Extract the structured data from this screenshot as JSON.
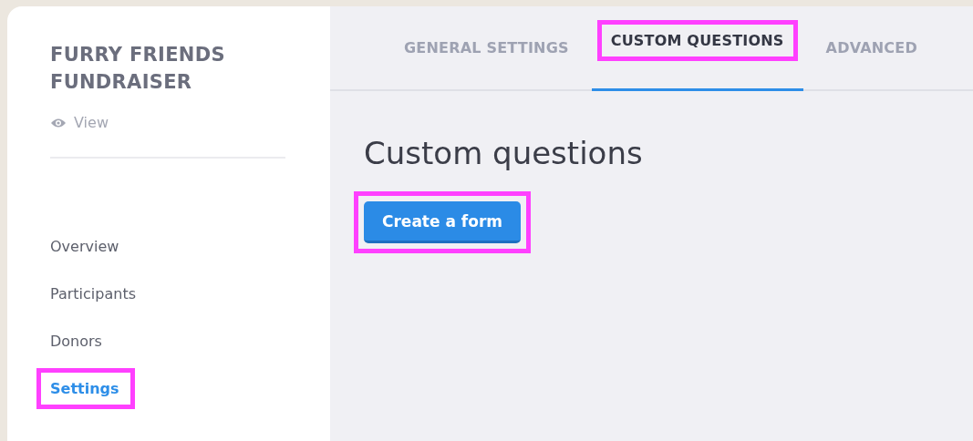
{
  "sidebar": {
    "title": "FURRY FRIENDS FUNDRAISER",
    "view_link": "View",
    "items": [
      {
        "label": "Overview",
        "selected": false,
        "highlighted": false
      },
      {
        "label": "Participants",
        "selected": false,
        "highlighted": false
      },
      {
        "label": "Donors",
        "selected": false,
        "highlighted": false
      },
      {
        "label": "Settings",
        "selected": true,
        "highlighted": true
      }
    ]
  },
  "tabs": [
    {
      "label": "GENERAL SETTINGS",
      "selected": false,
      "highlighted": false
    },
    {
      "label": "CUSTOM QUESTIONS",
      "selected": true,
      "highlighted": true
    },
    {
      "label": "ADVANCED",
      "selected": false,
      "highlighted": false
    }
  ],
  "content": {
    "heading": "Custom questions",
    "button": {
      "label": "Create a form",
      "highlighted": true
    }
  }
}
